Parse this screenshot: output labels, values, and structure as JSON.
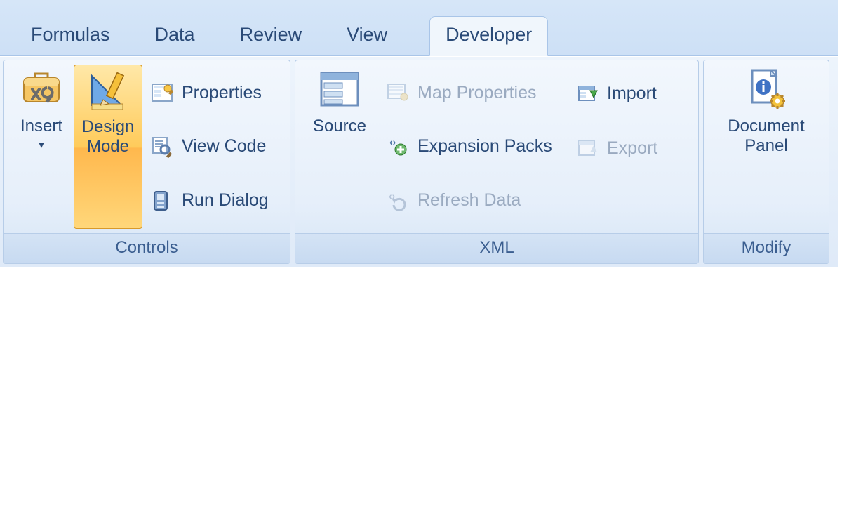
{
  "tabs": {
    "formulas": "Formulas",
    "data": "Data",
    "review": "Review",
    "view": "View",
    "developer": "Developer"
  },
  "groups": {
    "controls": {
      "label": "Controls",
      "insert": "Insert",
      "design_mode": "Design\nMode",
      "properties": "Properties",
      "view_code": "View Code",
      "run_dialog": "Run Dialog"
    },
    "xml": {
      "label": "XML",
      "source": "Source",
      "map_properties": "Map Properties",
      "expansion_packs": "Expansion Packs",
      "refresh_data": "Refresh Data",
      "import": "Import",
      "export": "Export"
    },
    "modify": {
      "label": "Modify",
      "document_panel": "Document\nPanel"
    }
  }
}
